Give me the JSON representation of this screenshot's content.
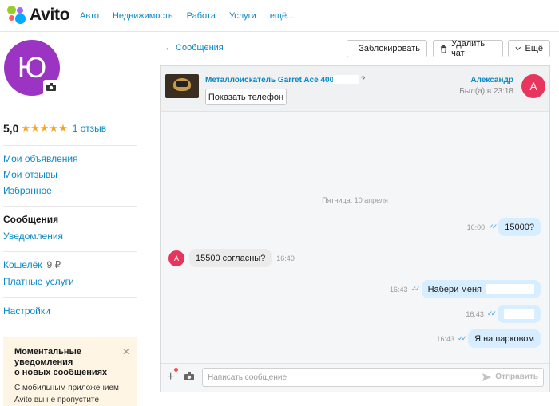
{
  "header": {
    "logo_text": "Avito",
    "nav": [
      "Авто",
      "Недвижимость",
      "Работа",
      "Услуги",
      "ещё..."
    ]
  },
  "profile": {
    "avatar_letter": "Ю",
    "rating": "5,0",
    "stars": "★★★★★",
    "stars_value": 5,
    "reviews": "1 отзыв"
  },
  "sidebar": {
    "my_ads": "Мои объявления",
    "my_reviews": "Мои отзывы",
    "favorites": "Избранное",
    "messages": "Сообщения",
    "notifications": "Уведомления",
    "wallet": "Кошелёк",
    "wallet_amount": "9 ₽",
    "paid_services": "Платные услуги",
    "settings": "Настройки"
  },
  "promo": {
    "title_lines": [
      "Моментальные",
      "уведомления",
      "о новых сообщениях"
    ],
    "body_lines": [
      "С мобильным приложением",
      "Avito вы не пропустите"
    ],
    "close": "✕"
  },
  "chat_toolbar": {
    "back": "← Сообщения",
    "block": "Заблокировать",
    "delete": "Удалить чат",
    "more": "Ещё"
  },
  "chat_header": {
    "item_title": "Металлоискатель Garret Ace 400i",
    "title_suffix": "?",
    "show_phone": "Показать телефон",
    "peer_name": "Александр",
    "peer_seen": "Был(а) в 23:18",
    "peer_avatar_letter": "А"
  },
  "messages": {
    "date_separator": "Пятница, 10 апреля",
    "m1": {
      "time": "16:00",
      "text": "15000?"
    },
    "m2": {
      "avatar_letter": "А",
      "text": "15500 согласны?",
      "time": "16:40"
    },
    "m3": {
      "time": "16:43",
      "text": "Набери меня"
    },
    "m4": {
      "time": "16:43"
    },
    "m5": {
      "time": "16:43",
      "text": "Я на парковом"
    }
  },
  "composer": {
    "placeholder": "Написать сообщение",
    "send": "Отправить"
  },
  "colors": {
    "link": "#0a88c9",
    "avatar_profile": "#9b34c3",
    "avatar_peer": "#e8355e",
    "bubble_out": "#d6eeff",
    "bubble_in": "#ebebeb",
    "star": "#f5a623",
    "promo_bg": "#fff5e5"
  }
}
